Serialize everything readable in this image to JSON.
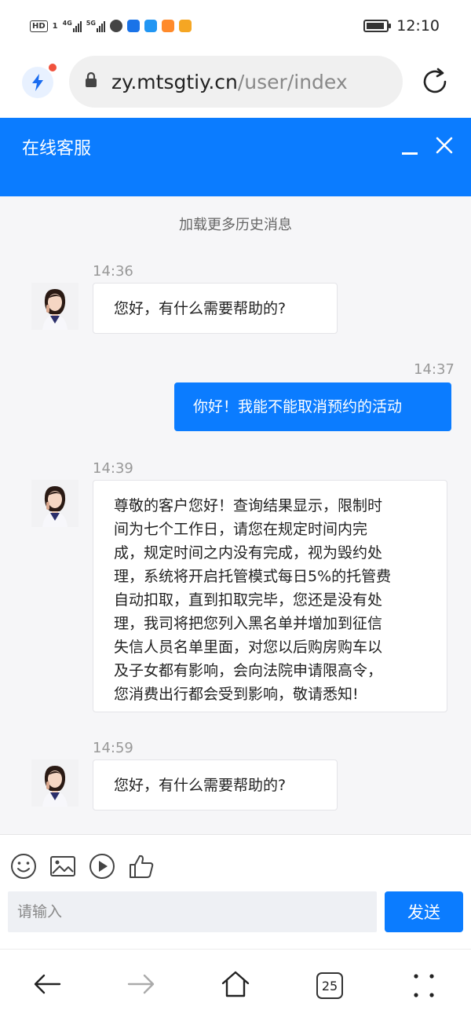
{
  "status_bar": {
    "hd_label": "HD",
    "sim_label": "1",
    "net1": "4G",
    "net2": "5G",
    "time": "12:10"
  },
  "browser": {
    "url_host": "zy.mtsgtiy.cn",
    "url_path": "/user/index",
    "tab_count": "25"
  },
  "chat_header": {
    "title": "在线客服"
  },
  "chat": {
    "load_more": "加载更多历史消息",
    "messages": [
      {
        "time": "14:36",
        "from": "agent",
        "text": "您好，有什么需要帮助的?"
      },
      {
        "time": "14:37",
        "from": "user",
        "text": "你好！我能不能取消预约的活动"
      },
      {
        "time": "14:39",
        "from": "agent",
        "lines": [
          "尊敬的客户您好！查询结果显示，限制时",
          "间为七个工作日，请您在规定时间内完",
          "成，规定时间之内没有完成，视为毁约处",
          "理，系统将开启托管模式每日5%的托管费",
          "自动扣取，直到扣取完毕，您还是没有处",
          "理，我司将把您列入黑名单并增加到征信",
          "失信人员名单里面，对您以后购房购车以",
          "及子女都有影响，会向法院申请限高令，",
          "您消费出行都会受到影响，敬请悉知!"
        ]
      },
      {
        "time": "14:59",
        "from": "agent",
        "text": "您好，有什么需要帮助的?"
      }
    ]
  },
  "input": {
    "placeholder": "请输入",
    "send_label": "发送"
  },
  "colors": {
    "accent": "#0b7cff",
    "chat_bg": "#f6f6f8"
  }
}
